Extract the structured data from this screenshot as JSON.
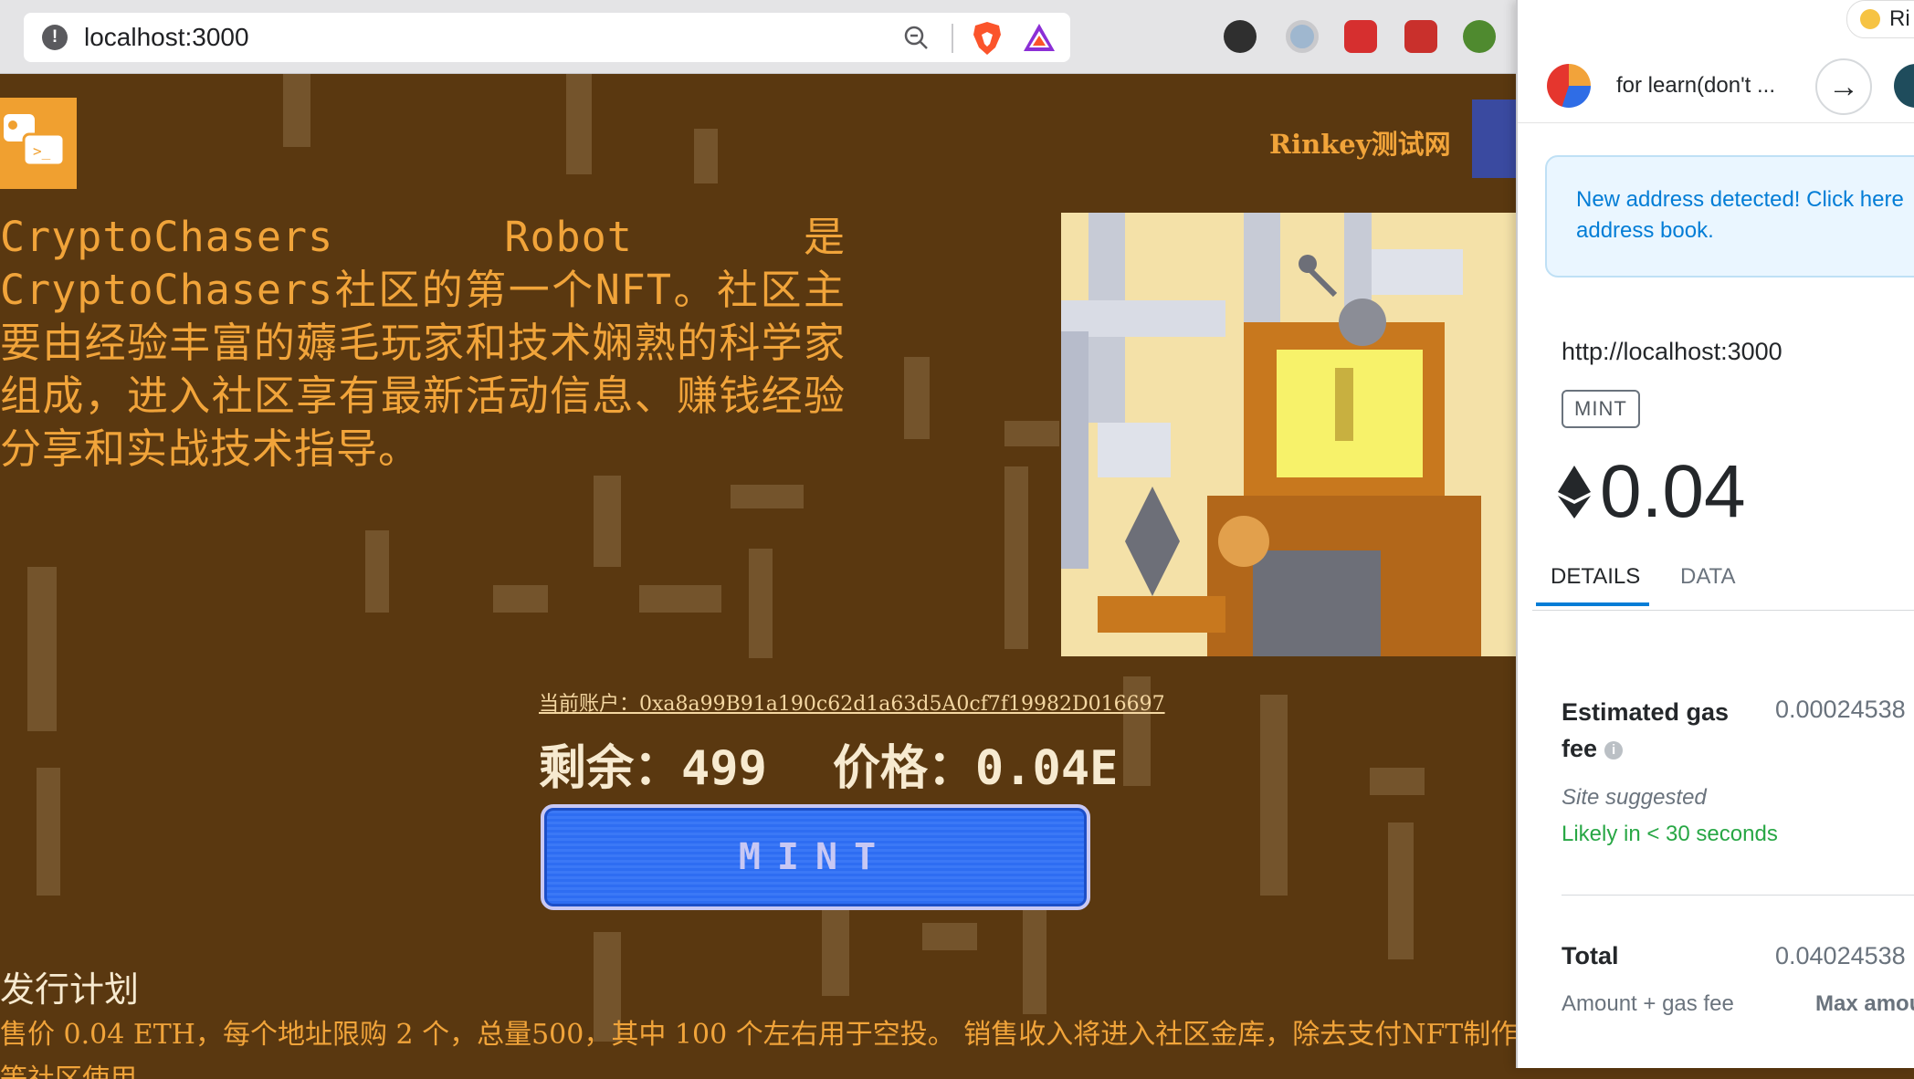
{
  "browser": {
    "url": "localhost:3000",
    "url_info": "!"
  },
  "page": {
    "network_label": "Rinkey测试网",
    "intro": "CryptoChasers Robot 是 CryptoChasers社区的第一个NFT。社区主要由经验丰富的薅毛玩家和技术娴熟的科学家组成，进入社区享有最新活动信息、赚钱经验分享和实战技术指导。",
    "account": "当前账户：0xa8a99B91a190c62d1a63d5A0cf7f19982D016697",
    "remaining": "剩余：499",
    "price": "价格：0.04E",
    "mint_button": "MINT",
    "plan_title": "发行计划",
    "plan_text": "售价 0.04 ETH，每个地址限购 2 个，总量500，其中 100 个左右用于空投。 销售收入将进入社区金库，除去支付NFT制作发行",
    "plan_text2": "等社区使用"
  },
  "wallet": {
    "network": "Ri",
    "account_name": "for learn(don't ...",
    "notice": "New address detected! Click here\naddress book.",
    "origin": "http://localhost:3000",
    "method": "MINT",
    "amount": "0.04",
    "tabs": [
      "DETAILS",
      "DATA"
    ],
    "fee_label": "Estimated gas\nfee",
    "fee_value": "0.00024538",
    "site_suggested": "Site suggested",
    "likely": "Likely in < 30 seconds",
    "total_label": "Total",
    "total_value": "0.04024538",
    "amount_gas": "Amount + gas fee",
    "max_amount": "Max amou"
  },
  "colors": {
    "page_bg": "#5a3810",
    "accent_orange": "#f1a43a",
    "mint_blue": "#2e6df2",
    "metamask_blue": "#037dd6",
    "success_green": "#28a745"
  }
}
